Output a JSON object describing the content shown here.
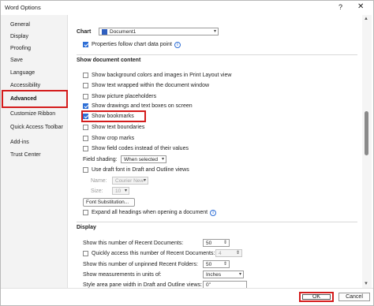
{
  "window": {
    "title": "Word Options",
    "help": "?",
    "close": "✕"
  },
  "sidebar": {
    "items": [
      {
        "label": "General"
      },
      {
        "label": "Display"
      },
      {
        "label": "Proofing"
      },
      {
        "label": "Save"
      },
      {
        "label": "Language"
      },
      {
        "label": "Accessibility"
      },
      {
        "label": "Advanced"
      },
      {
        "label": "Customize Ribbon"
      },
      {
        "label": "Quick Access Toolbar"
      },
      {
        "label": "Add-ins"
      },
      {
        "label": "Trust Center"
      }
    ]
  },
  "chart": {
    "label": "Chart",
    "document": "Document1",
    "properties_follow": "Properties follow chart data point"
  },
  "show_doc": {
    "heading": "Show document content",
    "items": [
      {
        "label": "Show background colors and images in Print Layout view",
        "checked": false
      },
      {
        "label": "Show text wrapped within the document window",
        "checked": false
      },
      {
        "label": "Show picture placeholders",
        "checked": false
      },
      {
        "label": "Show drawings and text boxes on screen",
        "checked": true
      },
      {
        "label": "Show bookmarks",
        "checked": true
      },
      {
        "label": "Show text boundaries",
        "checked": false
      },
      {
        "label": "Show crop marks",
        "checked": false
      },
      {
        "label": "Show field codes instead of their values",
        "checked": false
      }
    ],
    "field_shading_label": "Field shading:",
    "field_shading_value": "When selected",
    "draft_font": "Use draft font in Draft and Outline views",
    "name_label": "Name:",
    "name_value": "Courier New",
    "size_label": "Size:",
    "size_value": "10",
    "font_substitution": "Font Substitution...",
    "expand_headings": "Expand all headings when opening a document"
  },
  "display": {
    "heading": "Display",
    "recent_docs_label": "Show this number of Recent Documents:",
    "recent_docs_value": "50",
    "quick_access_label": "Quickly access this number of Recent Documents:",
    "quick_access_value": "4",
    "unpinned_label": "Show this number of unpinned Recent Folders:",
    "unpinned_value": "50",
    "measurements_label": "Show measurements in units of:",
    "measurements_value": "Inches",
    "style_area_label": "Style area pane width in Draft and Outline views:",
    "style_area_value": "0\""
  },
  "footer": {
    "ok": "OK",
    "cancel": "Cancel"
  }
}
